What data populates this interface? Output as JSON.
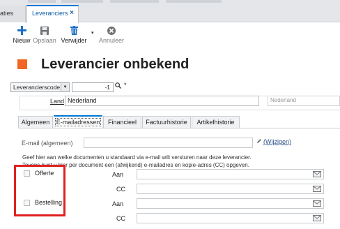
{
  "tabs": {
    "partial_label": "aties",
    "active_label": "Leveranciers",
    "active_close": "×"
  },
  "toolbar": {
    "new_label": "Nieuw",
    "save_label": "Opslaan",
    "delete_label": "Verwijder",
    "cancel_label": "Annuleer"
  },
  "header": {
    "title": "Leverancier onbekend",
    "accent_color": "#f26522"
  },
  "code": {
    "field_label": "Leverancierscode",
    "value": "-1",
    "required_mark": "*"
  },
  "land": {
    "label": "Land",
    "value": "Nederland",
    "value_secondary": "Nederland"
  },
  "subtabs": [
    {
      "label": "Algemeen"
    },
    {
      "label": "E-mailadressen"
    },
    {
      "label": "Financieel"
    },
    {
      "label": "Factuurhistorie"
    },
    {
      "label": "Artikelhistorie"
    }
  ],
  "email": {
    "label": "E-mail (algemeen)",
    "change_link": "(Wijzigen)",
    "info_line1": "Geef hier aan welke documenten u standaard via e-mail wilt versturen naar deze leverancier.",
    "info_line2": "Tevens kunt u hier per document een (afwijkend) e-mailadres en kopie-adres (CC) opgeven."
  },
  "documents": [
    {
      "label": "Offerte",
      "checked": false,
      "to_label": "Aan",
      "cc_label": "CC"
    },
    {
      "label": "Bestelling",
      "checked": false,
      "to_label": "Aan",
      "cc_label": "CC"
    }
  ],
  "colors": {
    "highlight_box": "#e02020",
    "toolbar_icon_blue": "#1f6fc5",
    "active_tab_accent": "#0078d4"
  },
  "icons": [
    "plus-icon",
    "save-icon",
    "trash-icon",
    "cancel-icon",
    "search-icon",
    "mail-icon",
    "edit-icon"
  ]
}
